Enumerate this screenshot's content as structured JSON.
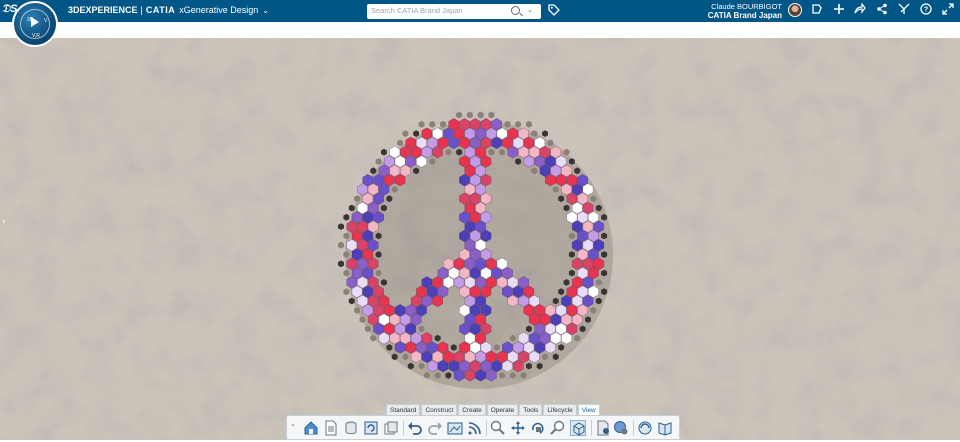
{
  "header": {
    "brand_3d": "3DEXPERIENCE",
    "brand_sep": "|",
    "brand_catia": "CATIA",
    "app_name": "xGenerative Design",
    "search_placeholder": "Search CATIA Brand Japan",
    "user_name": "Claude BOURBIGOT",
    "company": "CATIA Brand Japan",
    "compass_labels": {
      "top": "3D",
      "left": "",
      "right": "V",
      "bottom": "V,R"
    }
  },
  "header_icons": [
    "tag-icon",
    "share-icon",
    "plus-icon",
    "forward-icon",
    "network-icon",
    "tools-icon",
    "help-icon",
    "expand-icon"
  ],
  "action_bar": {
    "tabs": [
      "Standard",
      "Construct",
      "Create",
      "Operate",
      "Tools",
      "Lifecycle",
      "View"
    ],
    "active_tab": "View"
  },
  "colors": {
    "topbar": "#005686",
    "canvas": "#c5bdb3",
    "accent_red": "#e8344f",
    "accent_blue": "#4c3fb8",
    "accent_purple": "#8a5fc6",
    "white": "#ffffff"
  }
}
